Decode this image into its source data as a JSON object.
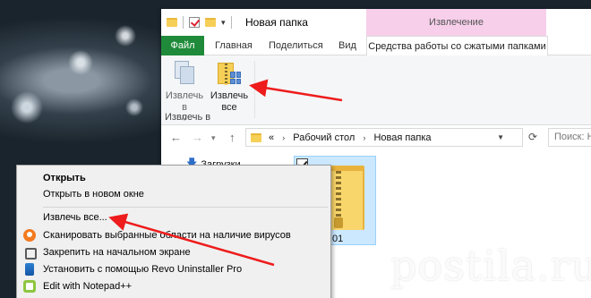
{
  "window": {
    "title": "Новая папка",
    "context_tab_header": "Извлечение"
  },
  "ribbon": {
    "tabs": {
      "file": "Файл",
      "home": "Главная",
      "share": "Поделиться",
      "view": "Вид",
      "compressed_tools": "Средства работы со сжатыми папками"
    },
    "extract_to_label": "Извлечь в",
    "extract_to_arrow": "˅",
    "extract_all_label": "Извлечь все",
    "group_label": "Извлечь в"
  },
  "addressbar": {
    "overflow": "«",
    "crumbs": [
      "Рабочий стол",
      "Новая папка"
    ],
    "search_placeholder": "Поиск: Н"
  },
  "navpane": {
    "items": [
      "Загрузки"
    ]
  },
  "file": {
    "name": "01",
    "checked": true
  },
  "context_menu": {
    "items": [
      "Открыть",
      "Открыть в новом окне",
      "Извлечь все...",
      "Сканировать выбранные области на наличие вирусов",
      "Закрепить на начальном экране",
      "Установить с помощью Revo Uninstaller Pro",
      "Edit with Notepad++"
    ]
  },
  "watermark": "postila.ru",
  "colors": {
    "file_tab": "#1f8b3a",
    "context_tab": "#f7cfea",
    "selection": "#cce8ff",
    "arrow": "#ee1c1c"
  }
}
